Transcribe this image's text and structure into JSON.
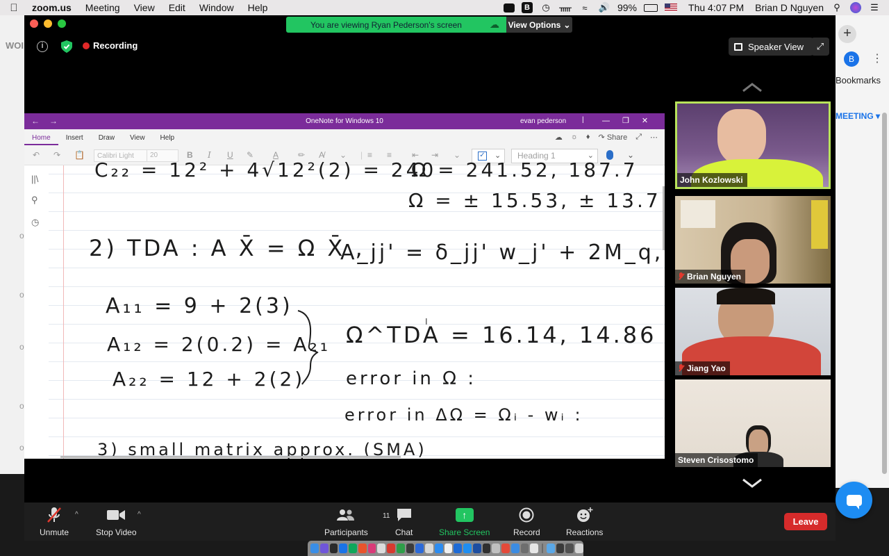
{
  "menubar": {
    "app_name": "zoom.us",
    "menus": [
      "Meeting",
      "View",
      "Edit",
      "Window",
      "Help"
    ],
    "battery": "99%",
    "clock": "Thu 4:07 PM",
    "user": "Brian D Nguyen",
    "icons": [
      "camera-icon",
      "b-app-icon",
      "time-machine-icon",
      "bluetooth-icon",
      "wifi-icon",
      "volume-icon",
      "battery-icon",
      "flag-icon",
      "search-icon",
      "siri-icon",
      "control-center-icon"
    ]
  },
  "background_browser": {
    "left_text": "WOI",
    "avatar_letter": "B",
    "bookmarks": "Bookmarks",
    "meeting": "MEETING"
  },
  "zoom": {
    "share_banner": "You are viewing Ryan Pederson's screen",
    "view_options": "View Options",
    "recording": "Recording",
    "speaker_view": "Speaker View",
    "colors": {
      "recording_red": "#e02828",
      "banner_green": "#22c561",
      "leave_red": "#d62b2b",
      "active_speaker": "#b8e35a"
    }
  },
  "onenote": {
    "window_title": "OneNote for Windows 10",
    "user": "evan pederson",
    "tabs": [
      "Home",
      "Insert",
      "Draw",
      "View",
      "Help"
    ],
    "share": "Share",
    "font": "Calibri Light",
    "font_size": "20",
    "style": "Heading 1",
    "handwriting": {
      "line1": "C₂₂ = 12² + 4√12²(2) = 240",
      "line2": "Ω = 241.52, 187.7",
      "line3": "Ω = ± 15.53, ± 13.7",
      "line4": "2) TDA :  A X̄ = Ω X̄ ,",
      "line5": "A_jj' = δ_jj' w_j' + 2M_q,q'",
      "line6": "A₁₁ = 9 + 2(3)",
      "line7": "A₁₂ = 2(0.2) = A₂₁",
      "line8": "A₂₂ = 12 + 2(2)",
      "line9": "Ω^TDA = 16.14, 14.86",
      "line10": "error in Ω :",
      "line11": "error in ΔΩ = Ωᵢ - wᵢ :",
      "line12": "3) small matrix approx. (SMA)"
    }
  },
  "participants": [
    {
      "name": "John Kozlowski",
      "muted": false,
      "active": true
    },
    {
      "name": "Brian Nguyen",
      "muted": true,
      "active": false
    },
    {
      "name": "Jiang Yao",
      "muted": true,
      "active": false
    },
    {
      "name": "Steven Crisostomo",
      "muted": false,
      "active": false
    }
  ],
  "toolbar": {
    "unmute": "Unmute",
    "stop_video": "Stop Video",
    "participants": "Participants",
    "participant_count": "11",
    "chat": "Chat",
    "share_screen": "Share Screen",
    "record": "Record",
    "reactions": "Reactions",
    "leave": "Leave"
  }
}
